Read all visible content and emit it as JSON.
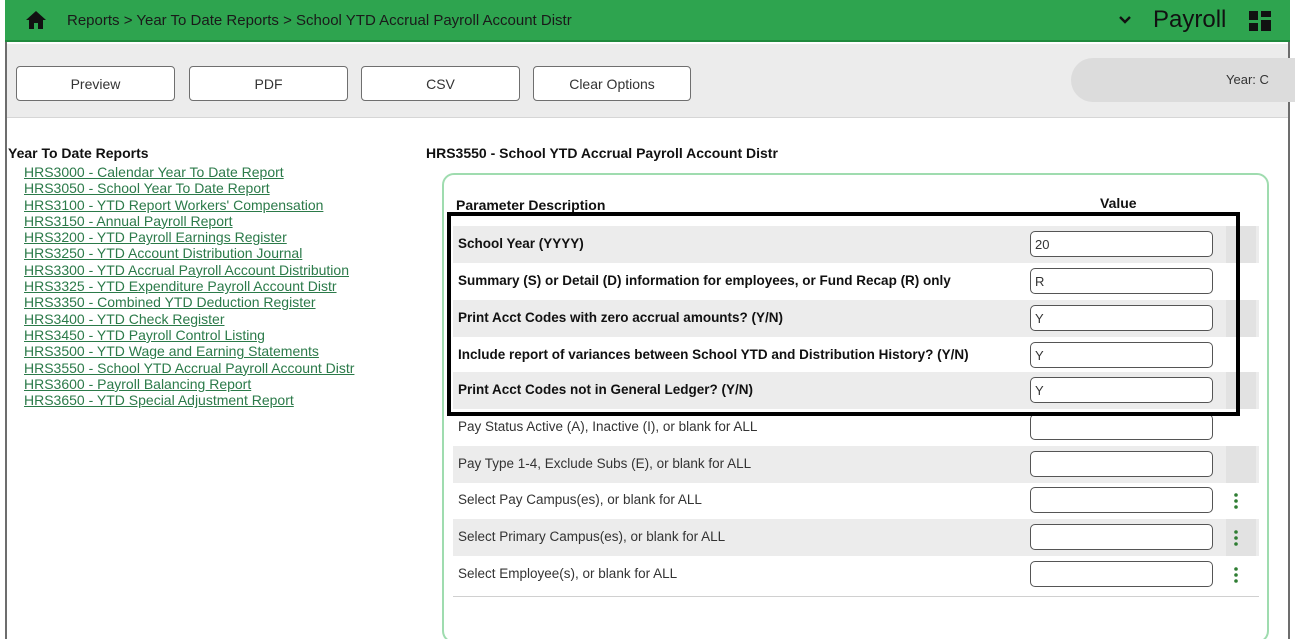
{
  "header": {
    "breadcrumb": "Reports > Year To Date Reports > School YTD Accrual Payroll Account Distr",
    "app_title": "Payroll"
  },
  "toolbar": {
    "preview_label": "Preview",
    "pdf_label": "PDF",
    "csv_label": "CSV",
    "clear_label": "Clear Options",
    "year_label": "Year: C"
  },
  "nav": {
    "title": "Year To Date Reports",
    "items": [
      {
        "label": "HRS3000 - Calendar Year To Date Report"
      },
      {
        "label": "HRS3050 - School Year To Date Report"
      },
      {
        "label": "HRS3100 - YTD Report Workers' Compensation"
      },
      {
        "label": "HRS3150 - Annual Payroll Report"
      },
      {
        "label": "HRS3200 - YTD Payroll Earnings Register"
      },
      {
        "label": "HRS3250 - YTD Account Distribution Journal"
      },
      {
        "label": "HRS3300 - YTD Accrual Payroll Account Distribution"
      },
      {
        "label": "HRS3325 - YTD Expenditure Payroll Account Distr"
      },
      {
        "label": "HRS3350 - Combined YTD Deduction Register"
      },
      {
        "label": "HRS3400 - YTD Check Register"
      },
      {
        "label": "HRS3450 - YTD Payroll Control Listing"
      },
      {
        "label": "HRS3500 - YTD Wage and Earning Statements"
      },
      {
        "label": "HRS3550 - School YTD Accrual Payroll Account Distr"
      },
      {
        "label": "HRS3600 - Payroll Balancing Report"
      },
      {
        "label": "HRS3650 - YTD Special Adjustment Report"
      }
    ]
  },
  "main": {
    "report_title": "HRS3550 - School YTD Accrual Payroll Account Distr",
    "col_description": "Parameter Description",
    "col_value": "Value",
    "params": [
      {
        "description": "School Year (YYYY)",
        "value": "20"
      },
      {
        "description": "Summary (S) or Detail (D) information for employees, or Fund Recap (R) only",
        "value": "R"
      },
      {
        "description": "Print Acct Codes with zero accrual amounts? (Y/N)",
        "value": "Y"
      },
      {
        "description": "Include report of variances between School YTD and Distribution History? (Y/N)",
        "value": "Y"
      },
      {
        "description": "Print Acct Codes not in General Ledger? (Y/N)",
        "value": "Y"
      },
      {
        "description": "Pay Status Active (A), Inactive (I), or blank for ALL",
        "value": ""
      },
      {
        "description": "Pay Type 1-4, Exclude Subs (E), or blank for ALL",
        "value": ""
      },
      {
        "description": "Select Pay Campus(es), or blank for ALL",
        "value": ""
      },
      {
        "description": "Select Primary Campus(es), or blank for ALL",
        "value": ""
      },
      {
        "description": "Select Employee(s), or blank for ALL",
        "value": ""
      }
    ]
  },
  "icons": {
    "home": "home-icon",
    "chevron": "chevron-down-icon",
    "apps": "grid-icon",
    "more": "kebab-icon"
  }
}
